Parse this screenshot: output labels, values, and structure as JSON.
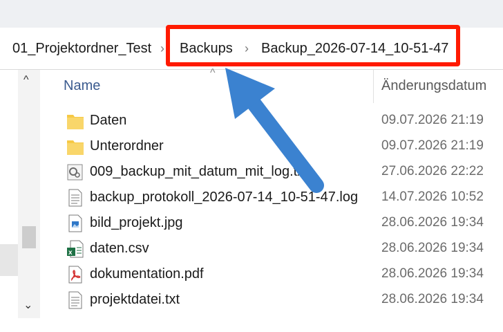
{
  "breadcrumb": {
    "items": [
      "01_Projektordner_Test",
      "Backups",
      "Backup_2026-07-14_10-51-47"
    ],
    "separator": "›"
  },
  "columns": {
    "name": "Name",
    "date": "Änderungsdatum"
  },
  "files": [
    {
      "name": "Daten",
      "date": "09.07.2026 21:19",
      "icon": "folder-icon"
    },
    {
      "name": "Unterordner",
      "date": "09.07.2026 21:19",
      "icon": "folder-icon"
    },
    {
      "name": "009_backup_mit_datum_mit_log.txt",
      "date": "27.06.2026 22:22",
      "icon": "script-file-icon"
    },
    {
      "name": "backup_protokoll_2026-07-14_10-51-47.log",
      "date": "14.07.2026 10:52",
      "icon": "text-file-icon"
    },
    {
      "name": "bild_projekt.jpg",
      "date": "28.06.2026 19:34",
      "icon": "image-file-icon"
    },
    {
      "name": "daten.csv",
      "date": "28.06.2026 19:34",
      "icon": "excel-file-icon"
    },
    {
      "name": "dokumentation.pdf",
      "date": "28.06.2026 19:34",
      "icon": "pdf-file-icon"
    },
    {
      "name": "projektdatei.txt",
      "date": "28.06.2026 19:34",
      "icon": "text-file-icon"
    }
  ],
  "scroll": {
    "up": "^",
    "down": "⌄"
  },
  "colors": {
    "highlight": "#ff1a00",
    "arrow": "#3b82d0",
    "folder": "#f6c945"
  }
}
